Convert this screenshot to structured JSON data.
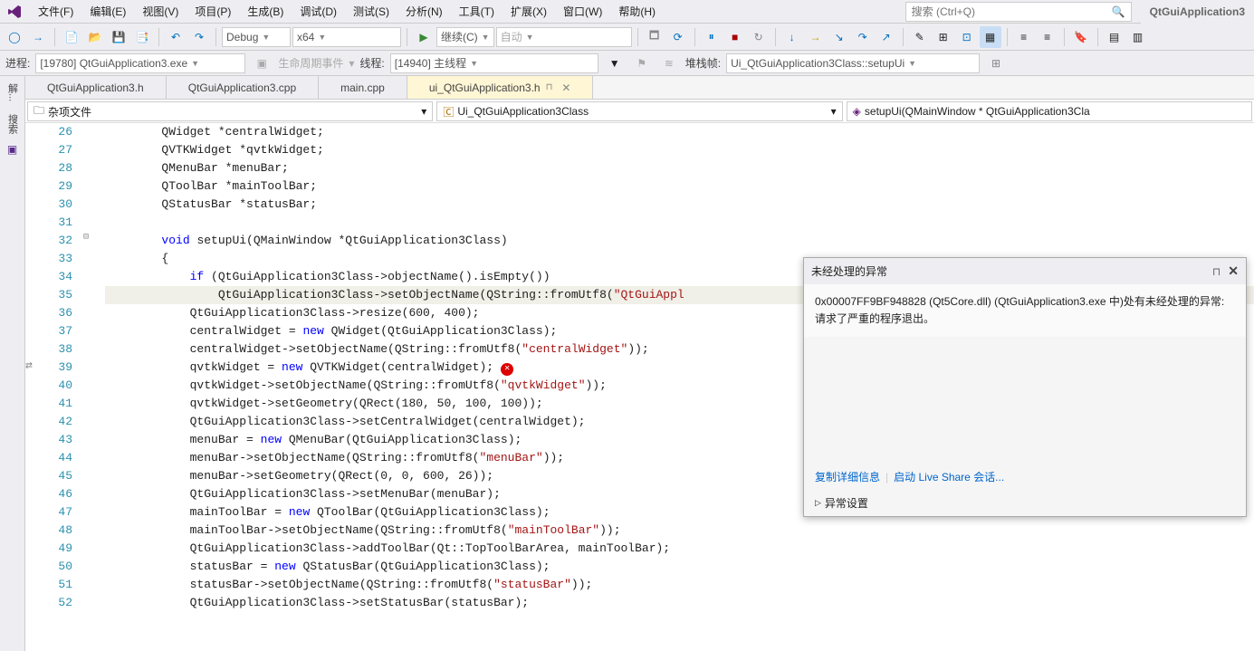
{
  "menu": {
    "items": [
      "文件(F)",
      "编辑(E)",
      "视图(V)",
      "项目(P)",
      "生成(B)",
      "调试(D)",
      "测试(S)",
      "分析(N)",
      "工具(T)",
      "扩展(X)",
      "窗口(W)",
      "帮助(H)"
    ]
  },
  "search_placeholder": "搜索 (Ctrl+Q)",
  "app_title": "QtGuiApplication3",
  "toolbar": {
    "config": "Debug",
    "platform": "x64",
    "continue_label": "继续(C)",
    "auto_label": "自动"
  },
  "debugbar": {
    "process_label": "进程:",
    "process_value": "[19780] QtGuiApplication3.exe",
    "lifecycle": "生命周期事件",
    "thread_label": "线程:",
    "thread_value": "[14940] 主线程",
    "stackframe_label": "堆栈帧:",
    "stackframe_value": "Ui_QtGuiApplication3Class::setupUi"
  },
  "sidebar": {
    "t1": "解...",
    "t2": "搜索"
  },
  "tabs": [
    {
      "label": "QtGuiApplication3.h",
      "active": false
    },
    {
      "label": "QtGuiApplication3.cpp",
      "active": false
    },
    {
      "label": "main.cpp",
      "active": false
    },
    {
      "label": "ui_QtGuiApplication3.h",
      "active": true
    }
  ],
  "nav": {
    "scope": "杂项文件",
    "class": "Ui_QtGuiApplication3Class",
    "func": "setupUi(QMainWindow * QtGuiApplication3Cla"
  },
  "lines": [
    26,
    27,
    28,
    29,
    30,
    31,
    32,
    33,
    34,
    35,
    36,
    37,
    38,
    39,
    40,
    41,
    42,
    43,
    44,
    45,
    46,
    47,
    48,
    49,
    50,
    51,
    52
  ],
  "code": {
    "l26": "        QWidget *centralWidget;",
    "l27": "        QVTKWidget *qvtkWidget;",
    "l28": "        QMenuBar *menuBar;",
    "l29": "        QToolBar *mainToolBar;",
    "l30": "        QStatusBar *statusBar;",
    "l31": "",
    "l32a": "        ",
    "l32b": "void",
    "l32c": " setupUi(QMainWindow *QtGuiApplication3Class)",
    "l33": "        {",
    "l34a": "            ",
    "l34b": "if",
    "l34c": " (QtGuiApplication3Class->objectName().isEmpty())",
    "l35a": "                QtGuiApplication3Class->setObjectName(QString::fromUtf8(",
    "l35b": "\"QtGuiAppl",
    "l36": "            QtGuiApplication3Class->resize(600, 400);",
    "l37a": "            centralWidget = ",
    "l37b": "new",
    "l37c": " QWidget(QtGuiApplication3Class);",
    "l38a": "            centralWidget->setObjectName(QString::fromUtf8(",
    "l38b": "\"centralWidget\"",
    "l38c": "));",
    "l39a": "            qvtkWidget = ",
    "l39b": "new",
    "l39c": " QVTKWidget(centralWidget);",
    "l40a": "            qvtkWidget->setObjectName(QString::fromUtf8(",
    "l40b": "\"qvtkWidget\"",
    "l40c": "));",
    "l41": "            qvtkWidget->setGeometry(QRect(180, 50, 100, 100));",
    "l42": "            QtGuiApplication3Class->setCentralWidget(centralWidget);",
    "l43a": "            menuBar = ",
    "l43b": "new",
    "l43c": " QMenuBar(QtGuiApplication3Class);",
    "l44a": "            menuBar->setObjectName(QString::fromUtf8(",
    "l44b": "\"menuBar\"",
    "l44c": "));",
    "l45": "            menuBar->setGeometry(QRect(0, 0, 600, 26));",
    "l46": "            QtGuiApplication3Class->setMenuBar(menuBar);",
    "l47a": "            mainToolBar = ",
    "l47b": "new",
    "l47c": " QToolBar(QtGuiApplication3Class);",
    "l48a": "            mainToolBar->setObjectName(QString::fromUtf8(",
    "l48b": "\"mainToolBar\"",
    "l48c": "));",
    "l49": "            QtGuiApplication3Class->addToolBar(Qt::TopToolBarArea, mainToolBar);",
    "l50a": "            statusBar = ",
    "l50b": "new",
    "l50c": " QStatusBar(QtGuiApplication3Class);",
    "l51a": "            statusBar->setObjectName(QString::fromUtf8(",
    "l51b": "\"statusBar\"",
    "l51c": "));",
    "l52": "            QtGuiApplication3Class->setStatusBar(statusBar);"
  },
  "popup": {
    "title": "未经处理的异常",
    "body": "0x00007FF9BF948828 (Qt5Core.dll) (QtGuiApplication3.exe 中)处有未经处理的异常: 请求了严重的程序退出。",
    "link1": "复制详细信息",
    "link2": "启动 Live Share 会话...",
    "expand": "异常设置"
  }
}
